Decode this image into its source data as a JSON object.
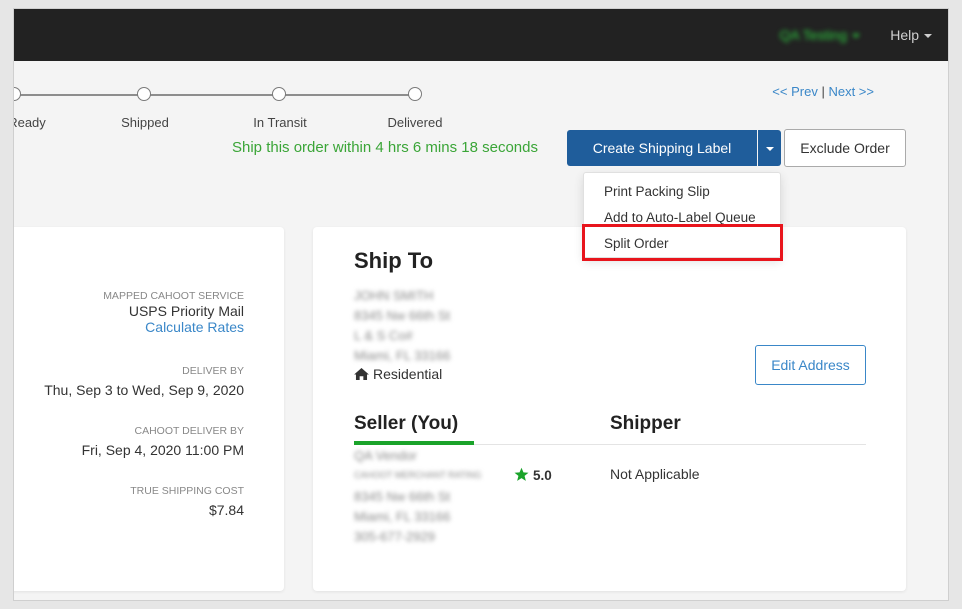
{
  "topnav": {
    "user_label": "QA Testing",
    "help_label": "Help"
  },
  "progress": {
    "steps": [
      "Ready",
      "Shipped",
      "In Transit",
      "Delivered"
    ]
  },
  "pager": {
    "prev_label": "<< Prev",
    "separator": "|",
    "next_label": "Next >>"
  },
  "countdown": "Ship this order within 4 hrs 6 mins 18 seconds",
  "actions": {
    "create_label": "Create Shipping Label",
    "exclude_label": "Exclude Order"
  },
  "dropdown": {
    "items": [
      "Print Packing Slip",
      "Add to Auto-Label Queue",
      "Split Order"
    ]
  },
  "details": {
    "mapped_service_label": "MAPPED CAHOOT SERVICE",
    "mapped_service_value": "USPS Priority Mail",
    "calculate_rates_label": "Calculate Rates",
    "deliver_by_label": "DELIVER BY",
    "deliver_by_value": "Thu, Sep 3 to Wed, Sep 9, 2020",
    "cahoot_deliver_by_label": "CAHOOT DELIVER BY",
    "cahoot_deliver_by_value": "Fri, Sep 4, 2020 11:00 PM",
    "true_cost_label": "TRUE SHIPPING COST",
    "true_cost_value": "$7.84"
  },
  "ship_to": {
    "title": "Ship To",
    "address_lines": [
      "JOHN SMITH",
      "8345 Nw 66th St",
      "L & S Co#",
      "Miami, FL 33166"
    ],
    "residential_label": "Residential",
    "edit_label": "Edit Address"
  },
  "seller": {
    "title": "Seller (You)",
    "vendor": "QA Vendor",
    "rating_caption": "CAHOOT MERCHANT RATING",
    "rating_value": "5.0",
    "address_lines": [
      "8345 Nw 66th St",
      "Miami, FL 33166",
      "305-677-2929"
    ]
  },
  "shipper": {
    "title": "Shipper",
    "value": "Not Applicable"
  },
  "colors": {
    "topbar": "#222222",
    "primary": "#1f5d9b",
    "link": "#3a87c8",
    "success": "#3aa537",
    "highlight": "#e8141c"
  }
}
